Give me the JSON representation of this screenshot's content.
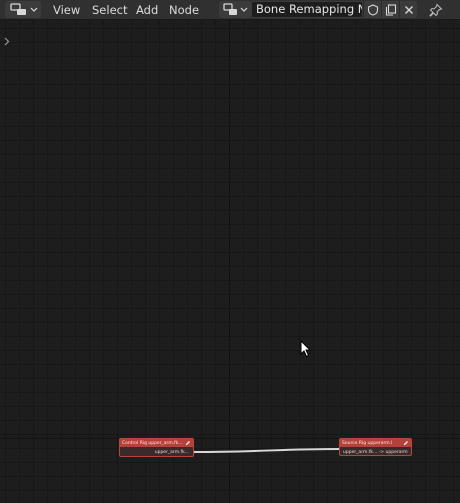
{
  "header": {
    "menus": [
      "View",
      "Select",
      "Add",
      "Node"
    ],
    "node_tree_name": "Bone Remapping No...",
    "icons": {
      "editor_type": "node-editor-icon",
      "tree_type": "node-tree-type-icon",
      "fake_user": "shield-icon",
      "duplicate": "copy-icon",
      "unlink": "close-icon",
      "pin": "pin-icon"
    }
  },
  "nodes": [
    {
      "header": "Control Rig upper_arm.fk...",
      "socket": "upper_arm.fk..."
    },
    {
      "header": "Source Rig upperarm.l",
      "socket": "upper_arm.fk... -> upperarm"
    }
  ],
  "colors": {
    "node_header": "#b4423a",
    "node_border": "#b4463c",
    "link": "#d8d8d8",
    "background": "#1d1d1d"
  }
}
